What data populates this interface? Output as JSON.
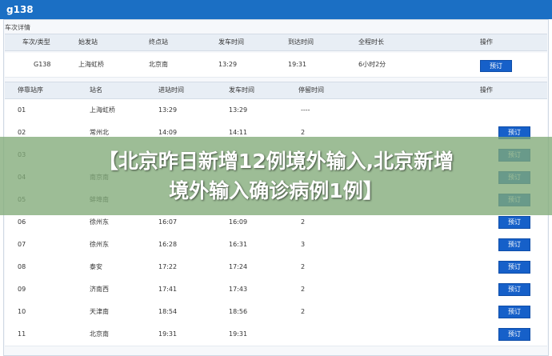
{
  "window": {
    "title": "g138"
  },
  "train_detail": {
    "section_title": "车次详情",
    "headers": [
      "车次/类型",
      "始发站",
      "终点站",
      "发车时间",
      "到达时间",
      "全程时长",
      "操作"
    ],
    "row": [
      "G138",
      "上海虹桥",
      "北京南",
      "13:29",
      "19:31",
      "6小时2分"
    ],
    "book_label": "预订"
  },
  "stops": {
    "headers": [
      "停靠站序",
      "站名",
      "进站时间",
      "发车时间",
      "停留时间",
      "操作"
    ],
    "book_label": "预订",
    "rows": [
      [
        "01",
        "上海虹桥",
        "13:29",
        "13:29",
        "----"
      ],
      [
        "02",
        "常州北",
        "14:09",
        "14:11",
        "2"
      ],
      [
        "03",
        "",
        "",
        "",
        ""
      ],
      [
        "04",
        "南京南",
        "",
        "",
        ""
      ],
      [
        "05",
        "蚌埠南",
        "",
        "",
        ""
      ],
      [
        "06",
        "徐州东",
        "16:07",
        "16:09",
        "2"
      ],
      [
        "07",
        "徐州东",
        "16:28",
        "16:31",
        "3"
      ],
      [
        "08",
        "泰安",
        "17:22",
        "17:24",
        "2"
      ],
      [
        "09",
        "济南西",
        "17:41",
        "17:43",
        "2"
      ],
      [
        "10",
        "天津南",
        "18:54",
        "18:56",
        "2"
      ],
      [
        "11",
        "北京南",
        "19:31",
        "19:31",
        ""
      ]
    ]
  },
  "overlay": {
    "line1": "【北京昨日新增12例境外输入,北京新增",
    "line2": "境外输入确诊病例1例】"
  }
}
